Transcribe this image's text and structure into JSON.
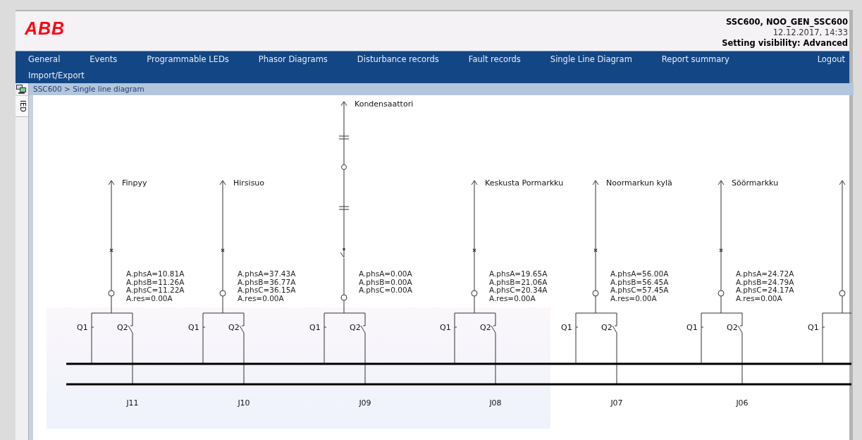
{
  "header": {
    "logo": "ABB",
    "device": "SSC600, NOO_GEN_SSC600",
    "datetime": "12.12.2017, 14:33",
    "visibility": "Setting visibility: Advanced"
  },
  "nav": [
    "General",
    "Events",
    "Programmable LEDs",
    "Phasor Diagrams",
    "Disturbance records",
    "Fault records",
    "Single Line Diagram",
    "Report summary",
    "Logout",
    "Import/Export"
  ],
  "breadcrumb": "SSC600 > Single line diagram",
  "side_tab": "IED",
  "diagram": {
    "feeders": [
      {
        "kind": "feeder",
        "name": "Finpyy",
        "breaker_closed": true,
        "measurements": [
          "A.phsA=10.81A",
          "A.phsB=11.26A",
          "A.phsC=11.22A",
          "A.res=0.00A"
        ],
        "q1": {
          "label": "Q1",
          "closed": true
        },
        "q2": {
          "label": "Q2",
          "closed": false
        },
        "bay": "J11"
      },
      {
        "kind": "feeder",
        "name": "Hirsisuo",
        "breaker_closed": true,
        "measurements": [
          "A.phsA=37.43A",
          "A.phsB=36.77A",
          "A.phsC=36.15A",
          "A.res=0.00A"
        ],
        "q1": {
          "label": "Q1",
          "closed": true
        },
        "q2": {
          "label": "Q2",
          "closed": false
        },
        "bay": "J10"
      },
      {
        "kind": "capacitor",
        "name": "Kondensaattori",
        "breaker_closed": false,
        "measurements": [
          "A.phsA=0.00A",
          "A.phsB=0.00A",
          "A.phsC=0.00A"
        ],
        "q1": {
          "label": "Q1",
          "closed": true
        },
        "q2": {
          "label": "Q2",
          "closed": false
        },
        "bay": "J09"
      },
      {
        "kind": "feeder",
        "name": "Keskusta Pormarkku",
        "breaker_closed": true,
        "measurements": [
          "A.phsA=19.65A",
          "A.phsB=21.06A",
          "A.phsC=20.34A",
          "A.res=0.00A"
        ],
        "q1": {
          "label": "Q1",
          "closed": true
        },
        "q2": {
          "label": "Q2",
          "closed": false
        },
        "bay": "J08"
      },
      {
        "kind": "feeder",
        "name": "Noormarkun kylä",
        "breaker_closed": true,
        "measurements": [
          "A.phsA=56.00A",
          "A.phsB=56.45A",
          "A.phsC=57.45A",
          "A.res=0.00A"
        ],
        "q1": {
          "label": "Q1",
          "closed": true
        },
        "q2": {
          "label": "Q2",
          "closed": false
        },
        "bay": "J07"
      },
      {
        "kind": "feeder",
        "name": "Söörmarkku",
        "breaker_closed": true,
        "measurements": [
          "A.phsA=24.72A",
          "A.phsB=24.79A",
          "A.phsC=24.17A",
          "A.res=0.00A"
        ],
        "q1": {
          "label": "Q1",
          "closed": true
        },
        "q2": {
          "label": "Q2",
          "closed": false
        },
        "bay": "J06"
      },
      {
        "kind": "feeder",
        "q1": {
          "label": "Q1",
          "closed": true
        }
      }
    ]
  }
}
